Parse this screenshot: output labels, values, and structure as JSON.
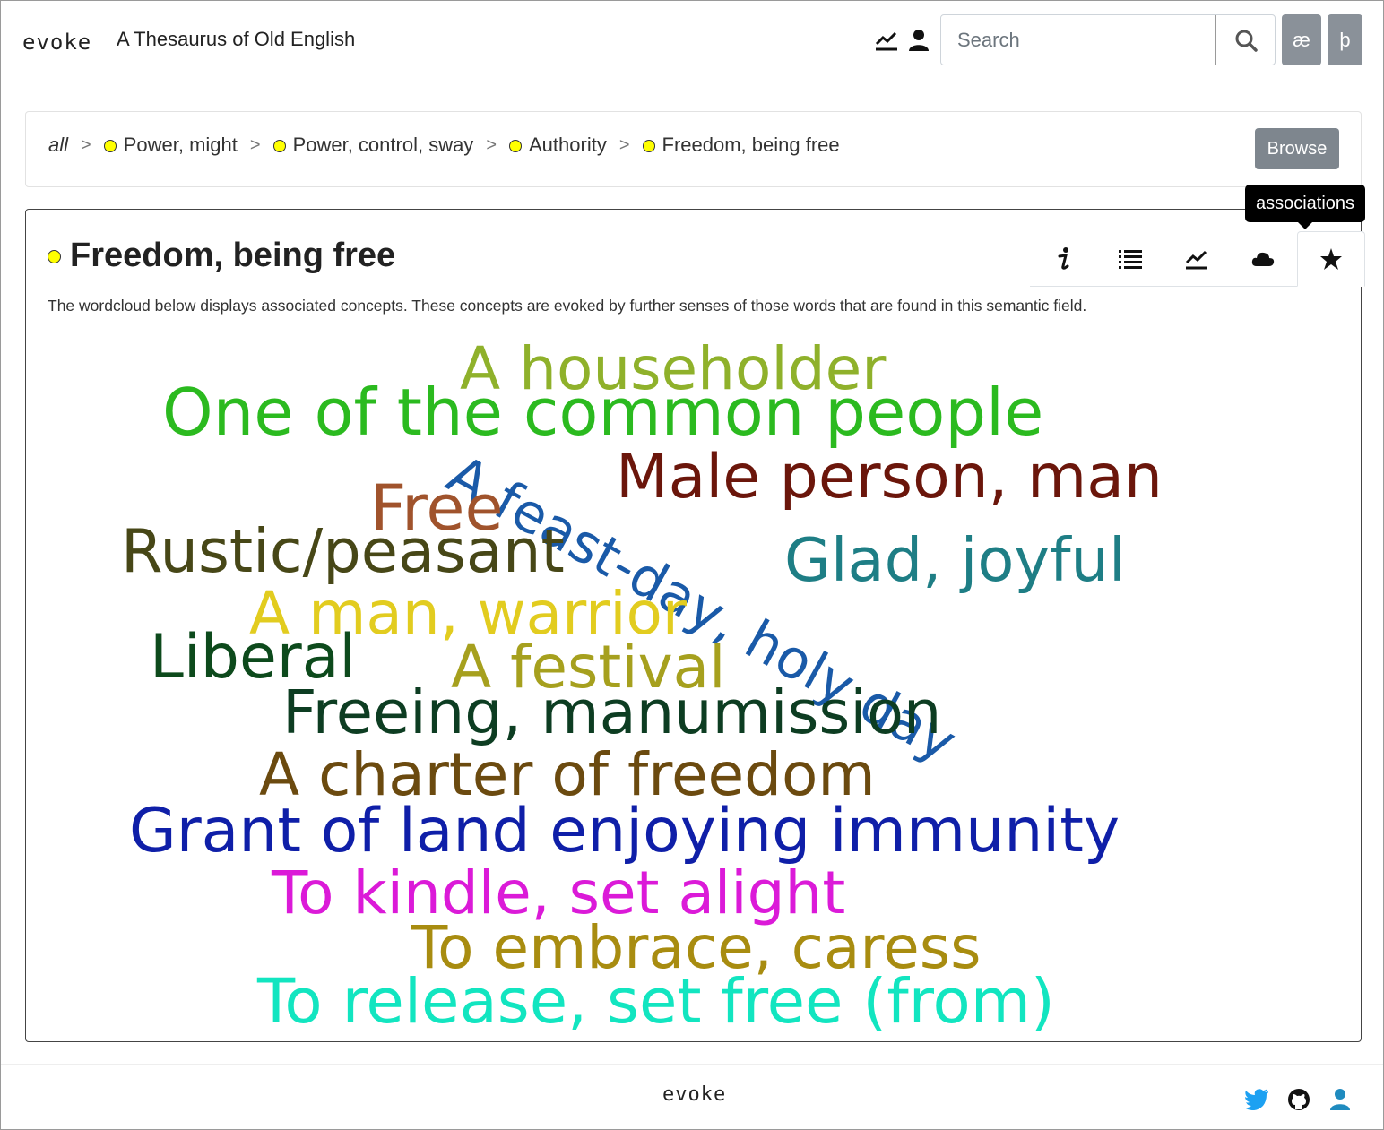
{
  "app": {
    "logo_text": "evoke",
    "title": "A Thesaurus of Old English"
  },
  "search": {
    "placeholder": "Search"
  },
  "char_buttons": [
    "æ",
    "þ"
  ],
  "breadcrumb": {
    "root": "all",
    "items": [
      "Power, might",
      "Power, control, sway",
      "Authority",
      "Freedom, being free"
    ],
    "separator": ">"
  },
  "browse_label": "Browse",
  "card": {
    "title": "Freedom, being free",
    "description": "The wordcloud below displays associated concepts. These concepts are evoked by further senses of those words that are found in this semantic field.",
    "tabs": [
      {
        "icon": "info-icon"
      },
      {
        "icon": "list-icon"
      },
      {
        "icon": "chart-icon"
      },
      {
        "icon": "cloud-icon"
      },
      {
        "icon": "star-icon",
        "active": true
      }
    ],
    "tooltip": "associations"
  },
  "wordcloud": [
    {
      "text": "A householder",
      "color": "#8fb12b"
    },
    {
      "text": "One of the common people",
      "color": "#2bba1f"
    },
    {
      "text": "A feast-day, holy day",
      "color": "#1a5aa8"
    },
    {
      "text": "Male person, man",
      "color": "#6b160b"
    },
    {
      "text": "Free",
      "color": "#a0532c"
    },
    {
      "text": "Rustic/peasant",
      "color": "#474717"
    },
    {
      "text": "Glad, joyful",
      "color": "#1e7e85"
    },
    {
      "text": "A man, warrior",
      "color": "#e2cc1f"
    },
    {
      "text": "Liberal",
      "color": "#0d4a1c"
    },
    {
      "text": "A festival",
      "color": "#a6a01e"
    },
    {
      "text": "Freeing, manumission",
      "color": "#0d3d22"
    },
    {
      "text": "A charter of freedom",
      "color": "#6b4a0f"
    },
    {
      "text": "Grant of land enjoying immunity",
      "color": "#0f1fa8"
    },
    {
      "text": "To kindle, set alight",
      "color": "#db1ad8"
    },
    {
      "text": "To embrace, caress",
      "color": "#a88c10"
    },
    {
      "text": "To release, set free (from)",
      "color": "#12e5c0"
    }
  ],
  "footer": {
    "logo_text": "evoke",
    "icons": [
      "twitter-icon",
      "github-icon",
      "user-icon"
    ]
  },
  "colors": {
    "accent": "#1f8bbf",
    "dot": "#ffff00",
    "button_gray": "#8a9199"
  }
}
